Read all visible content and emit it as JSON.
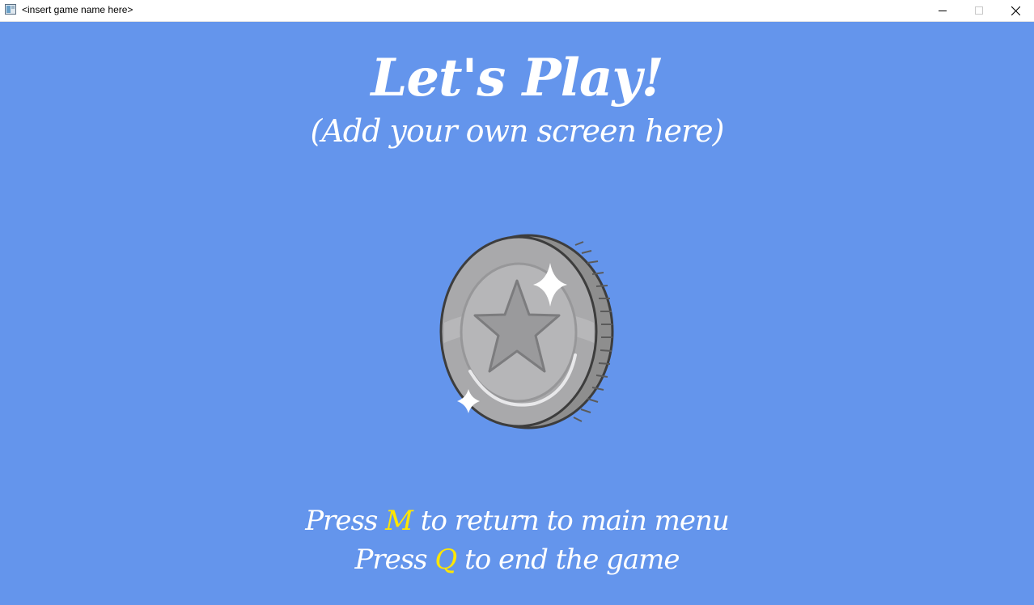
{
  "window": {
    "title": "<insert game name here>",
    "minimize_symbol": "minimize",
    "maximize_symbol": "maximize",
    "close_symbol": "close"
  },
  "screen": {
    "title": "Let's Play!",
    "subtitle": "(Add your own screen here)",
    "instructions": [
      {
        "prefix": "Press ",
        "key": "M",
        "suffix": " to return to main menu"
      },
      {
        "prefix": "Press ",
        "key": "Q",
        "suffix": " to end the game"
      }
    ],
    "center_image": "silver-coin-with-star-icon"
  },
  "colors": {
    "background": "#6495ec",
    "text": "#ffffff",
    "key_highlight": "#ffe600"
  }
}
